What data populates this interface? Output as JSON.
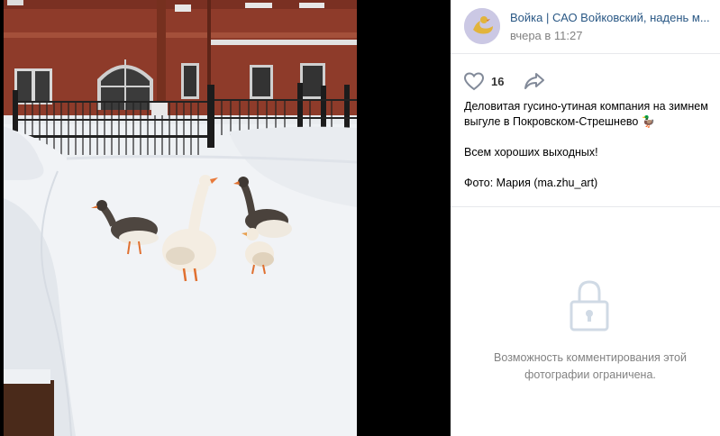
{
  "photo": {
    "alt_icon": "geese-photo"
  },
  "post": {
    "author": "Войка | САО Войковский, надень м...",
    "time": "вчера в 11:27",
    "likes": "16",
    "text_line1": "Деловитая гусино-утиная компания на зимнем выгуле в Покровском-Стрешнево 🦆",
    "text_line2": "Всем хороших выходных!",
    "text_line3": "Фото: Мария (ma.zhu_art)"
  },
  "comments": {
    "restricted_message": "Возможность комментирования этой фотографии ограничена."
  },
  "colors": {
    "link": "#2a5885",
    "muted": "#828282",
    "divider": "#e7e8ec"
  }
}
